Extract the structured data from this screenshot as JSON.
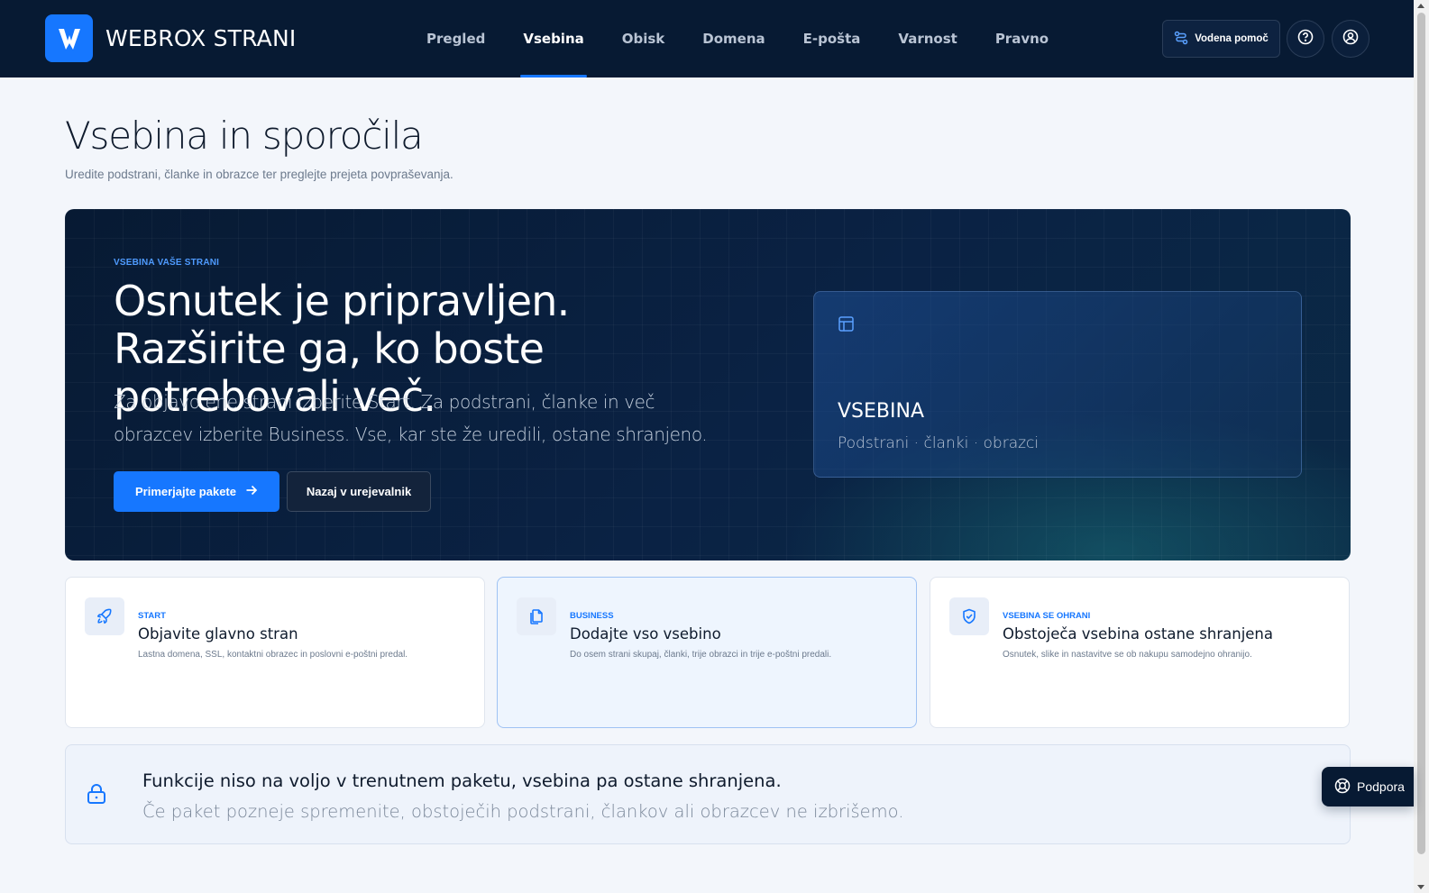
{
  "header": {
    "brand": "WEBROX STRANI",
    "nav": [
      "Pregled",
      "Vsebina",
      "Obisk",
      "Domena",
      "E-pošta",
      "Varnost",
      "Pravno"
    ],
    "active_nav": "Vsebina",
    "help_button": "Vodena pomoč"
  },
  "page": {
    "title": "Vsebina in sporočila",
    "subtitle": "Uredite podstrani, članke in obrazce ter preglejte prejeta povpraševanja."
  },
  "hero": {
    "eyebrow": "VSEBINA VAŠE STRANI",
    "title": "Osnutek je pripravljen. Razširite ga, ko boste potrebovali več.",
    "text": "Za objavo ene strani izberite Start. Za podstrani, članke in več obrazcev izberite Business. Vse, kar ste že uredili, ostane shranjeno.",
    "primary_button": "Primerjajte pakete",
    "secondary_button": "Nazaj v urejevalnik",
    "card": {
      "title": "VSEBINA",
      "subtitle": "Podstrani · članki · obrazci"
    }
  },
  "plans": [
    {
      "label": "START",
      "title": "Objavite glavno stran",
      "desc": "Lastna domena, SSL, kontaktni obrazec in poslovni e-poštni predal.",
      "icon": "rocket-icon"
    },
    {
      "label": "BUSINESS",
      "title": "Dodajte vso vsebino",
      "desc": "Do osem strani skupaj, članki, trije obrazci in trije e-poštni predali.",
      "icon": "pages-icon"
    },
    {
      "label": "VSEBINA SE OHRANI",
      "title": "Obstoječa vsebina ostane shranjena",
      "desc": "Osnutek, slike in nastavitve se ob nakupu samodejno ohranijo.",
      "icon": "shield-check-icon"
    }
  ],
  "notice": {
    "title": "Funkcije niso na voljo v trenutnem paketu, vsebina pa ostane shranjena.",
    "text": "Če paket pozneje spremenite, obstoječih podstrani, člankov ali obrazcev ne izbrišemo."
  },
  "support_button": "Podpora",
  "colors": {
    "header_bg": "#071a33",
    "accent": "#1677ff",
    "page_bg": "#f3f6fb"
  }
}
